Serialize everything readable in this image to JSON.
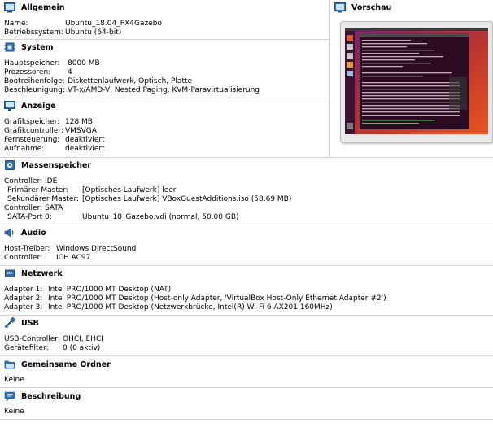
{
  "general": {
    "title": "Allgemein",
    "rows": [
      {
        "k": "Name:",
        "v": "Ubuntu_18.04_PX4Gazebo"
      },
      {
        "k": "Betriebssystem:",
        "v": "Ubuntu (64-bit)"
      }
    ]
  },
  "preview": {
    "title": "Vorschau"
  },
  "system": {
    "title": "System",
    "rows": [
      {
        "k": "Hauptspeicher:",
        "v": "8000 MB"
      },
      {
        "k": "Prozessoren:",
        "v": "4"
      },
      {
        "k": "Bootreihenfolge:",
        "v": "Diskettenlaufwerk, Optisch, Platte"
      },
      {
        "k": "Beschleunigung:",
        "v": "VT-x/AMD-V, Nested Paging, KVM-Paravirtualisierung"
      }
    ]
  },
  "display": {
    "title": "Anzeige",
    "rows": [
      {
        "k": "Grafikspeicher:",
        "v": "128 MB"
      },
      {
        "k": "Grafikcontroller:",
        "v": "VMSVGA"
      },
      {
        "k": "Fernsteuerung:",
        "v": "deaktiviert"
      },
      {
        "k": "Aufnahme:",
        "v": "deaktiviert"
      }
    ]
  },
  "storage": {
    "title": "Massenspeicher",
    "rows": [
      {
        "k": "Controller: IDE",
        "v": ""
      },
      {
        "k": " Primärer Master:",
        "v": "[Optisches Laufwerk] leer"
      },
      {
        "k": " Sekundärer Master:",
        "v": "[Optisches Laufwerk] VBoxGuestAdditions.iso (58.69 MB)"
      },
      {
        "k": "Controller: SATA",
        "v": ""
      },
      {
        "k": " SATA-Port 0:",
        "v": "Ubuntu_18_Gazebo.vdi (normal, 50.00 GB)"
      }
    ]
  },
  "audio": {
    "title": "Audio",
    "rows": [
      {
        "k": "Host-Treiber:",
        "v": "Windows DirectSound"
      },
      {
        "k": "Controller:",
        "v": "ICH AC97"
      }
    ]
  },
  "network": {
    "title": "Netzwerk",
    "rows": [
      {
        "k": "Adapter 1:",
        "v": "Intel PRO/1000 MT Desktop (NAT)"
      },
      {
        "k": "Adapter 2:",
        "v": "Intel PRO/1000 MT Desktop (Host-only Adapter, 'VirtualBox Host-Only Ethernet Adapter #2')"
      },
      {
        "k": "Adapter 3:",
        "v": "Intel PRO/1000 MT Desktop (Netzwerkbrücke, Intel(R) Wi-Fi 6 AX201 160MHz)"
      }
    ]
  },
  "usb": {
    "title": "USB",
    "rows": [
      {
        "k": "USB-Controller:",
        "v": "OHCI, EHCI"
      },
      {
        "k": "Gerätefilter:",
        "v": "0 (0 aktiv)"
      }
    ]
  },
  "shared": {
    "title": "Gemeinsame Ordner",
    "rows": [
      {
        "k": "Keine",
        "v": ""
      }
    ]
  },
  "description": {
    "title": "Beschreibung",
    "rows": [
      {
        "k": "Keine",
        "v": ""
      }
    ]
  },
  "colors": {
    "icon_blue": "#2f6fb3",
    "separator": "#d6d6d6",
    "ubuntu_purple": "#2c0a22",
    "ubuntu_orange": "#e05a2a"
  }
}
